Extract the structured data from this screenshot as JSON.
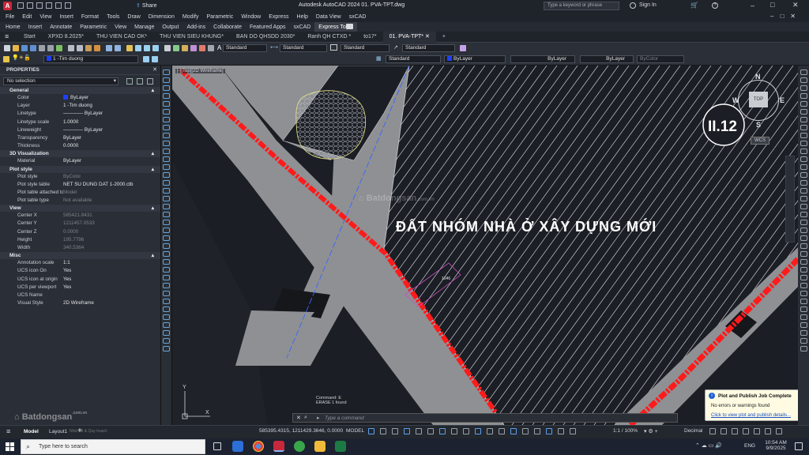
{
  "window": {
    "title": "Autodesk AutoCAD 2024   01. PVA-TPT.dwg",
    "share_label": "Share",
    "search_placeholder": "Type a keyword or phrase",
    "sign_in_label": "Sign In"
  },
  "menu": [
    "File",
    "Edit",
    "View",
    "Insert",
    "Format",
    "Tools",
    "Draw",
    "Dimension",
    "Modify",
    "Parametric",
    "Window",
    "Express",
    "Help",
    "Data View",
    "sxCAD"
  ],
  "ribbon_tabs": [
    "Home",
    "Insert",
    "Annotate",
    "Parametric",
    "View",
    "Manage",
    "Output",
    "Add-ins",
    "Collaborate",
    "Featured Apps",
    "sxCAD",
    "Express Tools"
  ],
  "doc_tabs": [
    {
      "label": "Start"
    },
    {
      "label": "XPXD 8.2025*"
    },
    {
      "label": "THU VIEN CAD OK*"
    },
    {
      "label": "THU VIEN SIEU KHUNG*"
    },
    {
      "label": "BAN DO QHSDD 2030*"
    },
    {
      "label": "Ranh QH CTXD *"
    },
    {
      "label": "to17*"
    },
    {
      "label": "01. PVA-TPT*"
    }
  ],
  "toolbar": {
    "layer_combo": "1 -Tim duong",
    "text_style": "Standard",
    "dim_style": "Standard",
    "table_style": "Standard",
    "mleader_style": "Standard",
    "plot_style": "Standard",
    "color": "ByLayer",
    "linetype": "ByLayer",
    "lineweight": "ByLayer",
    "plotstyle_color": "ByColor"
  },
  "properties": {
    "panel_title": "PROPERTIES",
    "selection": "No selection",
    "sections": [
      {
        "title": "General",
        "rows": [
          {
            "key": "Color",
            "value": "ByLayer",
            "dim": false
          },
          {
            "key": "Layer",
            "value": "1 -Tim duong",
            "dim": false
          },
          {
            "key": "Linetype",
            "value": "———— ByLayer",
            "dim": false
          },
          {
            "key": "Linetype scale",
            "value": "1.0000",
            "dim": false
          },
          {
            "key": "Lineweight",
            "value": "———— ByLayer",
            "dim": false
          },
          {
            "key": "Transparency",
            "value": "ByLayer",
            "dim": false
          },
          {
            "key": "Thickness",
            "value": "0.0000",
            "dim": false
          }
        ]
      },
      {
        "title": "3D Visualization",
        "rows": [
          {
            "key": "Material",
            "value": "ByLayer",
            "dim": false
          }
        ]
      },
      {
        "title": "Plot style",
        "rows": [
          {
            "key": "Plot style",
            "value": "ByColor",
            "dim": true
          },
          {
            "key": "Plot style table",
            "value": "NET SU DUNG DAT 1-2000.ctb",
            "dim": false
          },
          {
            "key": "Plot table attached to",
            "value": "Model",
            "dim": true
          },
          {
            "key": "Plot table type",
            "value": "Not available",
            "dim": true
          }
        ]
      },
      {
        "title": "View",
        "rows": [
          {
            "key": "Center X",
            "value": "585421.8431",
            "dim": true
          },
          {
            "key": "Center Y",
            "value": "1211457.0533",
            "dim": true
          },
          {
            "key": "Center Z",
            "value": "0.0000",
            "dim": true
          },
          {
            "key": "Height",
            "value": "195.7796",
            "dim": true
          },
          {
            "key": "Width",
            "value": "340.5364",
            "dim": true
          }
        ]
      },
      {
        "title": "Misc",
        "rows": [
          {
            "key": "Annotation scale",
            "value": "1:1",
            "dim": false
          },
          {
            "key": "UCS icon On",
            "value": "Yes",
            "dim": false
          },
          {
            "key": "UCS icon at origin",
            "value": "Yes",
            "dim": false
          },
          {
            "key": "UCS per viewport",
            "value": "Yes",
            "dim": false
          },
          {
            "key": "UCS Name",
            "value": "",
            "dim": false
          },
          {
            "key": "Visual Style",
            "value": "2D Wireframe",
            "dim": false
          }
        ]
      }
    ]
  },
  "canvas": {
    "viewport_label": "[-][Top][2D Wireframe]",
    "land_label": "ĐẤT NHÓM NHÀ Ở XÂY DỰNG MỚI",
    "zone_code": "II.12",
    "parcel_number": "1046",
    "viewcube": {
      "n": "N",
      "s": "S",
      "e": "E",
      "w": "W",
      "top": "TOP",
      "wcs": "WCS"
    },
    "watermark": "Batdongsan",
    "watermark_sub": ".com.vn",
    "watermark_tag": "Nhà đất & Quy hoạch",
    "ucs_y": "Y",
    "ucs_x": "X"
  },
  "command": {
    "history": [
      "Command: E",
      "ERASE 1 found"
    ],
    "placeholder": "Type a command"
  },
  "notification": {
    "title": "Plot and Publish Job Complete",
    "message": "No errors or warnings found",
    "link": "Click to view plot and publish details..."
  },
  "status": {
    "model_tab": "Model",
    "layout_tab": "Layout1",
    "coords": "585395.4315, 1211429.3646, 0.0000",
    "model_label": "MODEL",
    "scale": "1:1 / 100%",
    "units": "Decimal"
  },
  "taskbar": {
    "search_placeholder": "Type here to search",
    "language": "ENG",
    "time": "10:54 AM",
    "date": "9/9/2025"
  },
  "colors": {
    "road_fill": "#8e9093",
    "hatch": "#c9cdd2",
    "red_line": "#ff1b1b",
    "background": "#1b1e24"
  }
}
